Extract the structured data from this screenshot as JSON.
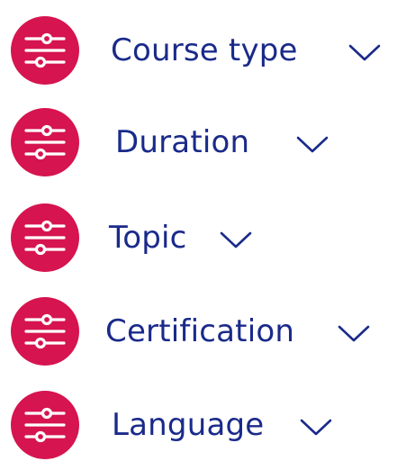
{
  "accent_color": "#d6144f",
  "text_color": "#1a2a8a",
  "filters": [
    {
      "label": "Course type",
      "icon": "sliders-icon",
      "chevron": "chevron-down-icon"
    },
    {
      "label": "Duration",
      "icon": "sliders-icon",
      "chevron": "chevron-down-icon"
    },
    {
      "label": "Topic",
      "icon": "sliders-icon",
      "chevron": "chevron-down-icon"
    },
    {
      "label": "Certification",
      "icon": "sliders-icon",
      "chevron": "chevron-down-icon"
    },
    {
      "label": "Language",
      "icon": "sliders-icon",
      "chevron": "chevron-down-icon"
    }
  ]
}
